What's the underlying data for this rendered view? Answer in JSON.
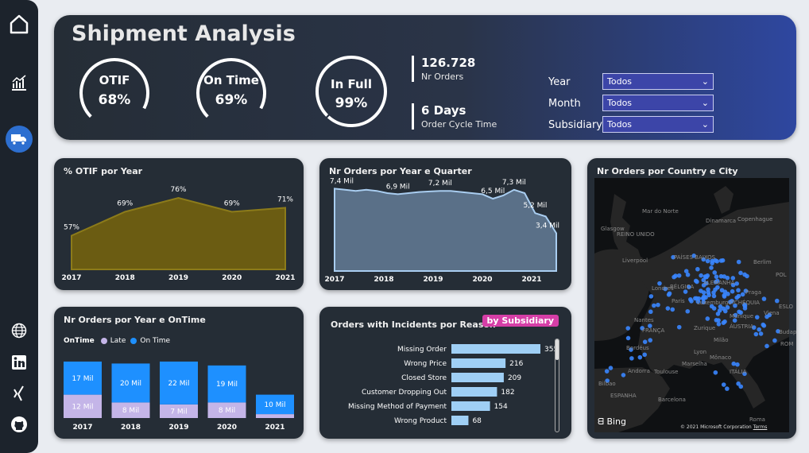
{
  "nav": {
    "items": [
      "home-icon",
      "chart-icon",
      "truck-icon"
    ],
    "social": [
      "globe-icon",
      "linkedin-icon",
      "xing-icon",
      "github-icon"
    ]
  },
  "header": {
    "title": "Shipment Analysis",
    "kpis": [
      {
        "label": "OTIF",
        "value": "68%",
        "progress": 0.68
      },
      {
        "label": "On Time",
        "value": "69%",
        "progress": 0.69
      },
      {
        "label": "In Full",
        "value": "99%",
        "progress": 0.99
      }
    ],
    "stats": [
      {
        "value": "126.728",
        "label": "Nr Orders"
      },
      {
        "value": "6 Days",
        "label": "Order Cycle Time"
      }
    ],
    "filters": [
      {
        "label": "Year",
        "value": "Todos"
      },
      {
        "label": "Month",
        "value": "Todos"
      },
      {
        "label": "Subsidiary",
        "value": "Todos"
      }
    ]
  },
  "otif_card": {
    "title": "% OTIF por Year"
  },
  "orders_quarter_card": {
    "title": "Nr Orders por Year e Quarter"
  },
  "ontime_card": {
    "title": "Nr Orders por Year e OnTime",
    "legend_title": "OnTime",
    "legend": [
      "Late",
      "On Time"
    ]
  },
  "incidents_card": {
    "title": "Orders with Incidents por Reason",
    "badge": "by Subsidiary"
  },
  "map_card": {
    "title": "Nr Orders por Country e City",
    "labels": [
      "Mar do Norte",
      "Dinamarca",
      "REINO UNIDO",
      "PAÍSES BAIXOS",
      "Berlim",
      "POL",
      "ALEMANHA",
      "BÉLGICA",
      "Paris",
      "Luxemburgo",
      "TCHÉQUIA",
      "FRANÇA",
      "ÁUSTRIA",
      "Mônaco",
      "ITÁLIA",
      "ESPANHA",
      "Andorra",
      "Roma",
      "Glasgow",
      "Liverpool",
      "Londres",
      "Copenhague",
      "Praga",
      "Viena",
      "Budapeste",
      "Munique",
      "Zurique",
      "Milão",
      "Marselha",
      "Bordéus",
      "Toulouse",
      "Lyon",
      "Bilbao",
      "Barcelona",
      "Nantes",
      "ESLO",
      "ROM"
    ],
    "bing": "Bing",
    "copyright": "© 2021 Microsoft Corporation",
    "terms": "Terms"
  },
  "colors": {
    "accent": "#1e90ff",
    "late": "#c4b5e8",
    "olive": "#6b5c12",
    "steel": "#5a7088",
    "bar_light": "#9fcff5"
  },
  "chart_data": [
    {
      "type": "area",
      "title": "% OTIF por Year",
      "x": [
        "2017",
        "2018",
        "2019",
        "2020",
        "2021"
      ],
      "values": [
        57,
        69,
        76,
        69,
        71
      ],
      "labels": [
        "57%",
        "69%",
        "76%",
        "69%",
        "71%"
      ],
      "ylim": [
        40,
        80
      ]
    },
    {
      "type": "area",
      "title": "Nr Orders por Year e Quarter",
      "x": [
        "2017",
        "2018",
        "2019",
        "2020",
        "2021"
      ],
      "values": [
        7.4,
        7.3,
        7.2,
        7.3,
        7.2,
        7.0,
        6.9,
        7.0,
        7.1,
        7.15,
        7.2,
        7.2,
        7.1,
        7.0,
        6.9,
        6.5,
        6.8,
        7.3,
        7.0,
        5.2,
        4.9,
        3.4
      ],
      "labels": [
        {
          "i": 0,
          "t": "7,4 Mil"
        },
        {
          "i": 6,
          "t": "6,9 Mil"
        },
        {
          "i": 10,
          "t": "7,2 Mil"
        },
        {
          "i": 15,
          "t": "6,5 Mil"
        },
        {
          "i": 17,
          "t": "7,3 Mil"
        },
        {
          "i": 19,
          "t": "5,2 Mil"
        },
        {
          "i": 21,
          "t": "3,4 Mil"
        }
      ],
      "ylim": [
        0,
        8
      ]
    },
    {
      "type": "bar",
      "title": "Nr Orders por Year e OnTime",
      "categories": [
        "2017",
        "2018",
        "2019",
        "2020",
        "2021"
      ],
      "series": [
        {
          "name": "Late",
          "values": [
            12,
            8,
            7,
            8,
            2
          ],
          "labels": [
            "12 Mil",
            "8 Mil",
            "7 Mil",
            "8 Mil",
            ""
          ]
        },
        {
          "name": "On Time",
          "values": [
            17,
            20,
            22,
            19,
            10
          ],
          "labels": [
            "17 Mil",
            "20 Mil",
            "22 Mil",
            "19 Mil",
            "10 Mil"
          ]
        }
      ]
    },
    {
      "type": "bar",
      "title": "Orders with Incidents por Reason",
      "categories": [
        "Missing Order",
        "Wrong Price",
        "Closed Store",
        "Customer Dropping Out",
        "Missing Method of Payment",
        "Wrong Product"
      ],
      "values": [
        355,
        216,
        209,
        182,
        154,
        68
      ]
    }
  ]
}
